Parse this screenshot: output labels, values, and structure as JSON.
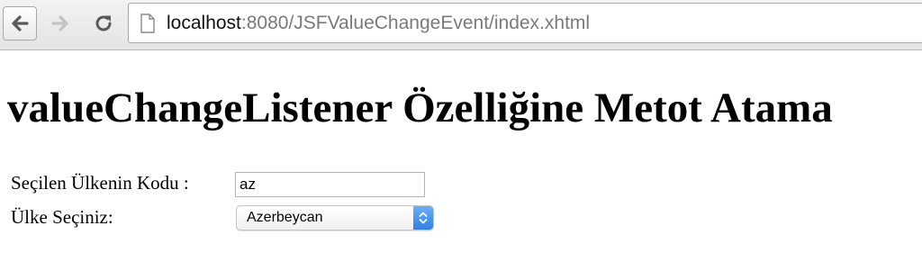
{
  "browser": {
    "url_host": "localhost",
    "url_rest": ":8080/JSFValueChangeEvent/index.xhtml"
  },
  "page": {
    "title": "valueChangeListener Özelliğine Metot Atama",
    "form": {
      "code_label": "Seçilen Ülkenin Kodu :",
      "code_value": "az",
      "country_label": "Ülke Seçiniz:",
      "country_selected": "Azerbeycan"
    }
  },
  "icons": {
    "back": "arrow-left-icon",
    "forward": "arrow-right-icon",
    "reload": "reload-icon",
    "page": "page-icon",
    "stepper": "chevron-up-down-icon"
  },
  "colors": {
    "stepper_accent": "#3f8ef0"
  }
}
